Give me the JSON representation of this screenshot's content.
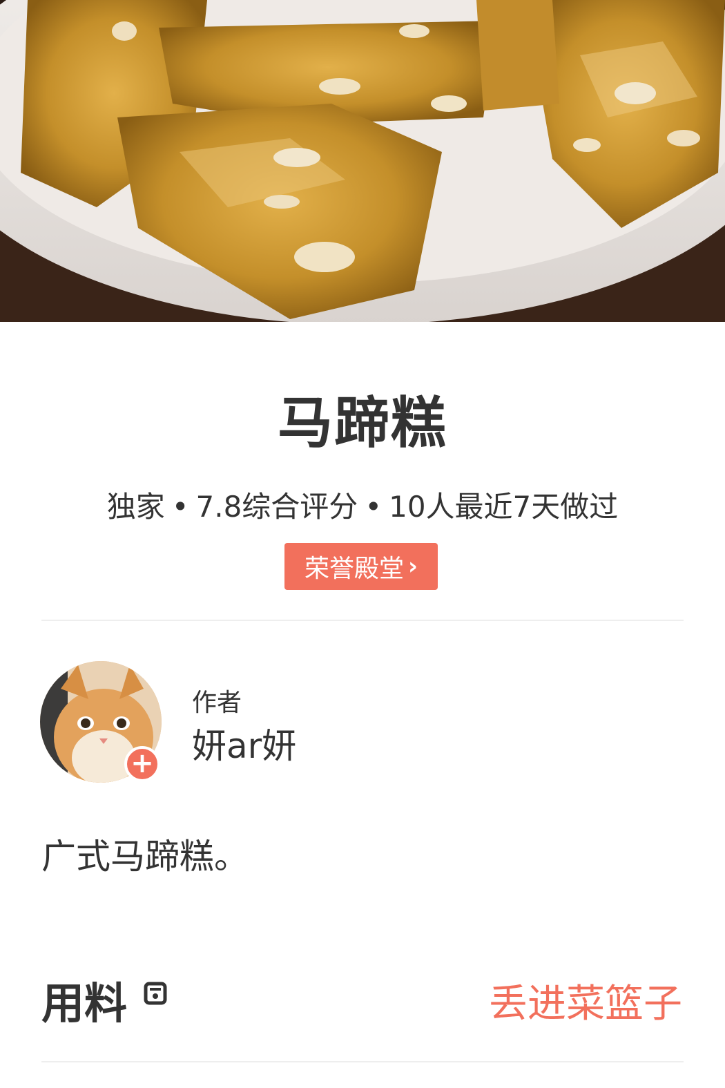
{
  "hero": {
    "image": "food-photo"
  },
  "recipe": {
    "title": "马蹄糕",
    "meta": {
      "tag": "独家",
      "rating": "7.8综合评分",
      "made": "10人最近7天做过",
      "separator": "•"
    },
    "honor_button": "荣誉殿堂",
    "honor_chevron": "›",
    "description": "广式马蹄糕。"
  },
  "author": {
    "label": "作者",
    "name": "妍ar妍",
    "follow_symbol": "+"
  },
  "ingredients": {
    "title": "用料",
    "icon": "scale-icon",
    "basket_link": "丢进菜篮子"
  },
  "colors": {
    "accent": "#f2705c",
    "text": "#333333",
    "divider": "#eeeeee"
  }
}
